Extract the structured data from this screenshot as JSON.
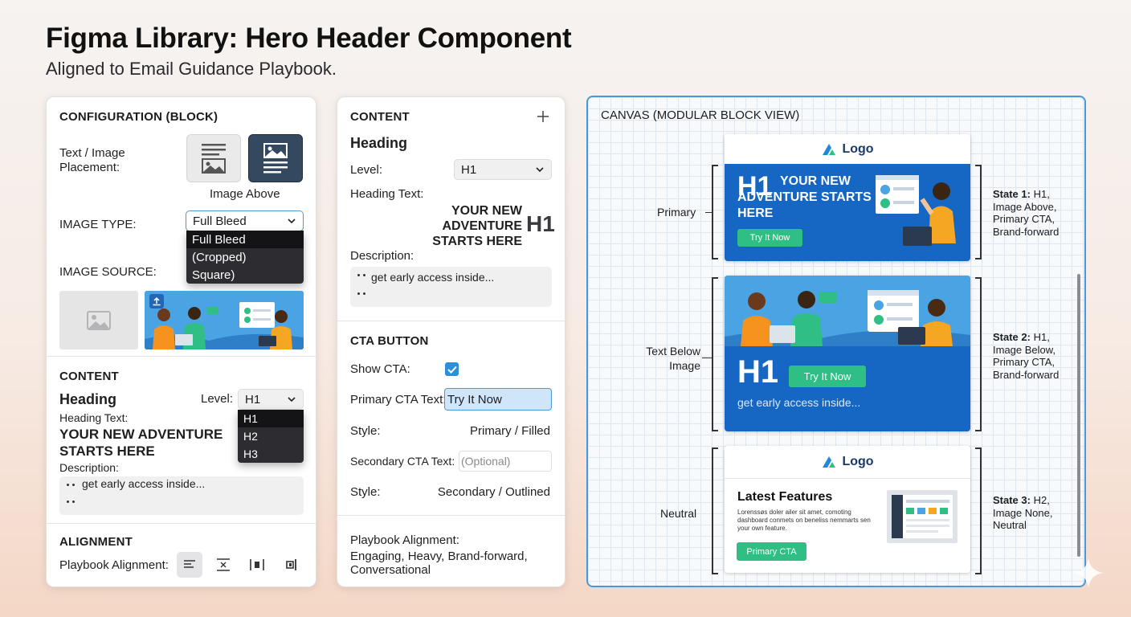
{
  "header": {
    "title": "Figma Library: Hero Header Component",
    "subtitle": "Aligned to Email Guidance Playbook."
  },
  "config_panel": {
    "title": "CONFIGURATION (BLOCK)",
    "placement_label": "Text / Image Placement:",
    "placement_options": [
      "Image Below",
      "Image Above"
    ],
    "placement_selected": "Image Above",
    "image_type_label": "IMAGE TYPE:",
    "image_type_value": "Full Bleed",
    "image_type_options": [
      "Full Bleed",
      "(Cropped)",
      "Square)"
    ],
    "image_source_label": "IMAGE SOURCE:",
    "content_title": "CONTENT",
    "heading_label": "Heading",
    "level_label": "Level:",
    "level_value": "H1",
    "level_options": [
      "H1",
      "H2",
      "H3"
    ],
    "heading_text_label": "Heading Text:",
    "heading_text": "YOUR NEW ADVENTURE STARTS HERE",
    "description_label": "Description:",
    "description_text": "get early access inside...",
    "alignment_title": "ALIGNMENT",
    "playbook_alignment_label": "Playbook Alignment:",
    "alignment_icons": [
      "align-left-icon",
      "align-center-icon",
      "align-split-icon",
      "align-right-icon"
    ]
  },
  "content_panel": {
    "title": "CONTENT",
    "add_icon": "plus-icon",
    "heading_label": "Heading",
    "level_label": "Level:",
    "level_value": "H1",
    "heading_text_label": "Heading Text:",
    "heading_text": "YOUR NEW ADVENTURE STARTS HERE",
    "heading_level_badge": "H1",
    "description_label": "Description:",
    "description_text": "get early access inside...",
    "cta_title": "CTA BUTTON",
    "show_cta_label": "Show CTA:",
    "show_cta_checked": true,
    "primary_cta_label": "Primary CTA Text:",
    "primary_cta_value": "Try It Now",
    "style_label": "Style:",
    "primary_style_value": "Primary / Filled",
    "secondary_cta_label": "Secondary CTA Text:",
    "secondary_cta_placeholder": "(Optional)",
    "secondary_style_value": "Secondary / Outlined",
    "playbook_label": "Playbook Alignment:",
    "playbook_value": "Engaging, Heavy, Brand-forward, Conversational"
  },
  "canvas": {
    "title": "CANVAS (MODULAR BLOCK VIEW)",
    "states": [
      {
        "side_label": "Primary",
        "logo": "Logo",
        "heading_level": "H1",
        "heading": "YOUR NEW ADVENTURE STARTS HERE",
        "cta": "Try It Now",
        "note_title": "State 1:",
        "note_text": "H1, Image Above, Primary CTA, Brand-forward"
      },
      {
        "side_label": "Text Below Image",
        "heading_level": "H1",
        "cta": "Try It Now",
        "description": "get early access inside...",
        "note_title": "State 2:",
        "note_text": "H1, Image Below, Primary CTA, Brand-forward"
      },
      {
        "side_label": "Neutral",
        "logo": "Logo",
        "heading": "Latest Features",
        "body": "Lorenssøs doler ailer sit amet, comoting dashboard conmets on beneliss nemmarts sen your own feature.",
        "cta": "Primary CTA",
        "note_title": "State 3:",
        "note_text": "H2, Image None, Neutral"
      }
    ]
  },
  "colors": {
    "brand_blue": "#1667c3",
    "cta_green": "#2fbf85",
    "panel_dark": "#2d2d31",
    "canvas_border": "#4c98d4"
  }
}
